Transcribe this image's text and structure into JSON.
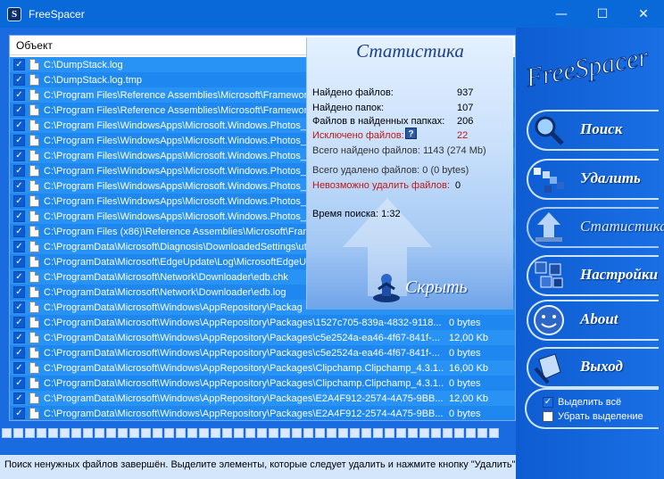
{
  "window": {
    "title": "FreeSpacer",
    "minimize": "—",
    "maximize": "☐",
    "close": "✕"
  },
  "list": {
    "header": "Объект",
    "rows": [
      {
        "path": "C:\\DumpStack.log",
        "size": ""
      },
      {
        "path": "C:\\DumpStack.log.tmp",
        "size": ""
      },
      {
        "path": "C:\\Program Files\\Reference Assemblies\\Microsoft\\Framework",
        "size": ""
      },
      {
        "path": "C:\\Program Files\\Reference Assemblies\\Microsoft\\Framework",
        "size": ""
      },
      {
        "path": "C:\\Program Files\\WindowsApps\\Microsoft.Windows.Photos_2",
        "size": ""
      },
      {
        "path": "C:\\Program Files\\WindowsApps\\Microsoft.Windows.Photos_2",
        "size": ""
      },
      {
        "path": "C:\\Program Files\\WindowsApps\\Microsoft.Windows.Photos_2",
        "size": ""
      },
      {
        "path": "C:\\Program Files\\WindowsApps\\Microsoft.Windows.Photos_2",
        "size": ""
      },
      {
        "path": "C:\\Program Files\\WindowsApps\\Microsoft.Windows.Photos_2",
        "size": ""
      },
      {
        "path": "C:\\Program Files\\WindowsApps\\Microsoft.Windows.Photos_2",
        "size": ""
      },
      {
        "path": "C:\\Program Files\\WindowsApps\\Microsoft.Windows.Photos_2",
        "size": ""
      },
      {
        "path": "C:\\Program Files (x86)\\Reference Assemblies\\Microsoft\\Frame",
        "size": ""
      },
      {
        "path": "C:\\ProgramData\\Microsoft\\Diagnosis\\DownloadedSettings\\ut",
        "size": ""
      },
      {
        "path": "C:\\ProgramData\\Microsoft\\EdgeUpdate\\Log\\MicrosoftEdgeU",
        "size": ""
      },
      {
        "path": "C:\\ProgramData\\Microsoft\\Network\\Downloader\\edb.chk",
        "size": ""
      },
      {
        "path": "C:\\ProgramData\\Microsoft\\Network\\Downloader\\edb.log",
        "size": ""
      },
      {
        "path": "C:\\ProgramData\\Microsoft\\Windows\\AppRepository\\Packag",
        "size": ""
      },
      {
        "path": "C:\\ProgramData\\Microsoft\\Windows\\AppRepository\\Packages\\1527c705-839a-4832-9118...",
        "size": "0 bytes"
      },
      {
        "path": "C:\\ProgramData\\Microsoft\\Windows\\AppRepository\\Packages\\c5e2524a-ea46-4f67-841f-...",
        "size": "12,00 Kb"
      },
      {
        "path": "C:\\ProgramData\\Microsoft\\Windows\\AppRepository\\Packages\\c5e2524a-ea46-4f67-841f-...",
        "size": "0 bytes"
      },
      {
        "path": "C:\\ProgramData\\Microsoft\\Windows\\AppRepository\\Packages\\Clipchamp.Clipchamp_4.3.1...",
        "size": "16,00 Kb"
      },
      {
        "path": "C:\\ProgramData\\Microsoft\\Windows\\AppRepository\\Packages\\Clipchamp.Clipchamp_4.3.1...",
        "size": "0 bytes"
      },
      {
        "path": "C:\\ProgramData\\Microsoft\\Windows\\AppRepository\\Packages\\E2A4F912-2574-4A75-9BB...",
        "size": "12,00 Kb"
      },
      {
        "path": "C:\\ProgramData\\Microsoft\\Windows\\AppRepository\\Packages\\E2A4F912-2574-4A75-9BB...",
        "size": "0 bytes"
      }
    ]
  },
  "stats": {
    "title": "Статистика",
    "files_found_label": "Найдено файлов:",
    "files_found": "937",
    "folders_found_label": "Найдено папок:",
    "folders_found": "107",
    "files_in_folders_label": "Файлов в найденных папках:",
    "files_in_folders": "206",
    "excluded_label": "Исключено файлов:",
    "excluded_icon": "?",
    "excluded": "22",
    "total_found": "Всего найдено файлов:   1143 (274 Mb)",
    "total_deleted": "Всего удалено файлов:   0 (0 bytes)",
    "cannot_delete_label": "Невозможно удалить файлов:",
    "cannot_delete": "0",
    "search_time": "Время поиска: 1:32",
    "hide_label": "Скрыть"
  },
  "menu": {
    "logo_text": "FreeSpacer",
    "search": "Поиск",
    "delete": "Удалить",
    "statistics": "Статистика",
    "settings": "Настройки",
    "about": "About",
    "exit": "Выход",
    "select_all": "Выделить всё",
    "deselect": "Убрать выделение"
  },
  "status": {
    "text": "Поиск ненужных файлов завершён. Выделите элементы, которые следует удалить и нажмите кнопку \"Удалить\""
  },
  "colors": {
    "accent": "#1a6be0",
    "row": "#2893f5",
    "alert": "#c41414"
  }
}
